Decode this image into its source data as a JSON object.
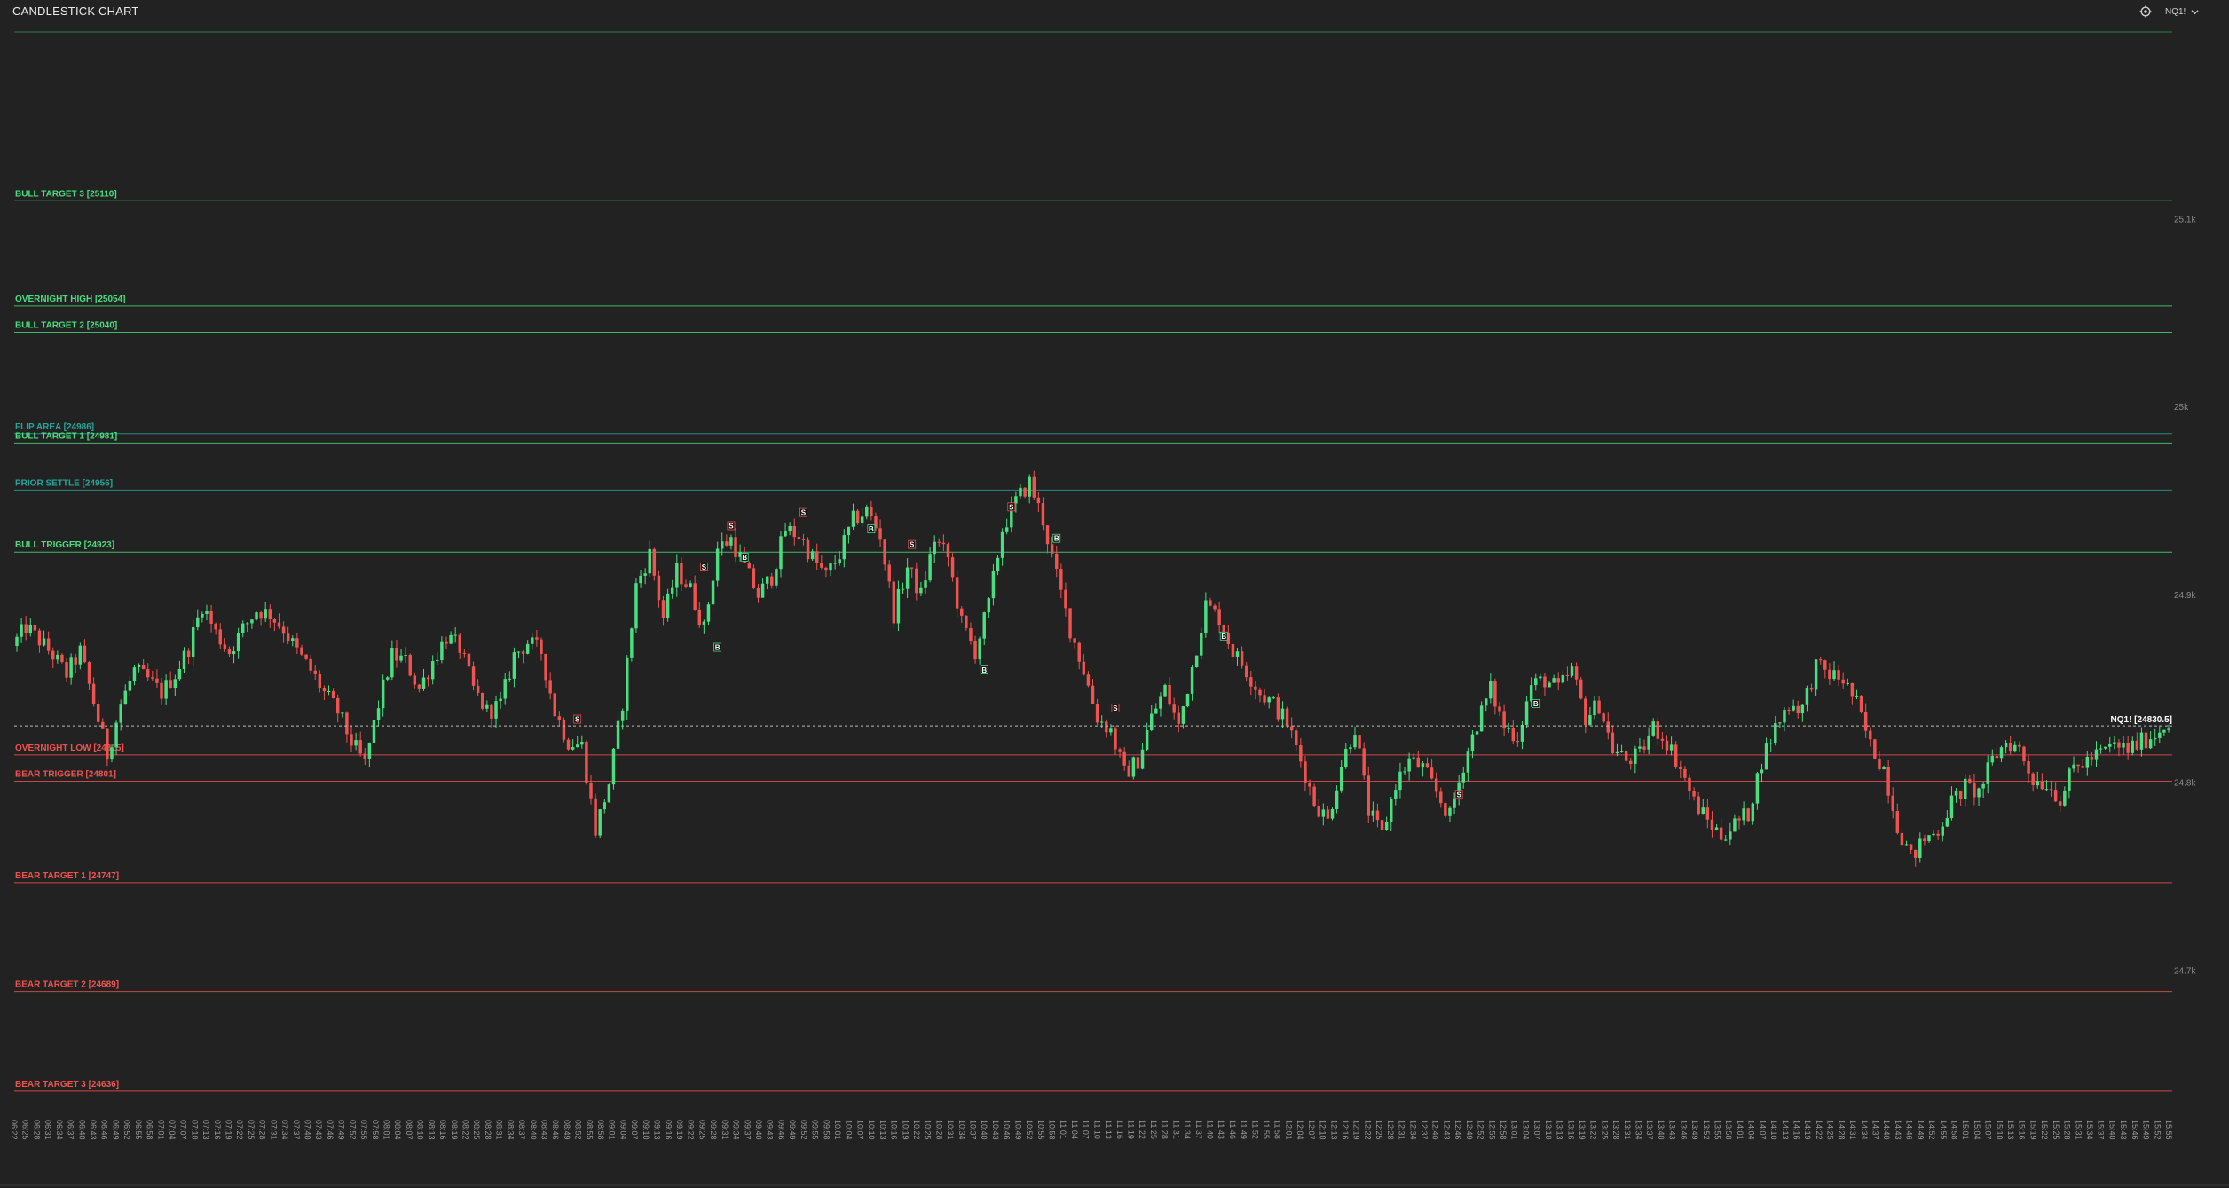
{
  "header": {
    "title": "CANDLESTICK CHART",
    "settings_icon": "gear-icon",
    "symbol": "NQ1!",
    "symbol_dropdown_icon": "chevron-down-icon"
  },
  "colors": {
    "background": "#222222",
    "bull": "#4ade80",
    "bear": "#ef5350",
    "flip": "#26a69a",
    "current_price_line": "#bdbdbd"
  },
  "chart_data": {
    "type": "candlestick",
    "symbol": "NQ1!",
    "ylim": [
      24630,
      25205
    ],
    "y_ticks": [
      {
        "value": 25100,
        "label": "25.1k"
      },
      {
        "value": 25000,
        "label": "25k"
      },
      {
        "value": 24900,
        "label": "24.9k"
      },
      {
        "value": 24800,
        "label": "24.8k"
      },
      {
        "value": 24700,
        "label": "24.7k"
      }
    ],
    "levels": [
      {
        "label": "BULL TARGET 3 [25110]",
        "value": 25110,
        "kind": "bull"
      },
      {
        "label": "OVERNIGHT HIGH [25054]",
        "value": 25054,
        "kind": "bull"
      },
      {
        "label": "BULL TARGET 2 [25040]",
        "value": 25040,
        "kind": "bull"
      },
      {
        "label": "FLIP AREA [24986]",
        "value": 24986,
        "kind": "flip"
      },
      {
        "label": "BULL TARGET 1 [24981]",
        "value": 24981,
        "kind": "bull"
      },
      {
        "label": "PRIOR SETTLE [24956]",
        "value": 24956,
        "kind": "flip"
      },
      {
        "label": "BULL TRIGGER [24923]",
        "value": 24923,
        "kind": "bull"
      },
      {
        "label": "OVERNIGHT LOW [24815]",
        "value": 24815,
        "kind": "bear"
      },
      {
        "label": "BEAR TRIGGER [24801]",
        "value": 24801,
        "kind": "bear"
      },
      {
        "label": "BEAR TARGET 1 [24747]",
        "value": 24747,
        "kind": "bear"
      },
      {
        "label": "BEAR TARGET 2 [24689]",
        "value": 24689,
        "kind": "bear"
      },
      {
        "label": "BEAR TARGET 3 [24636]",
        "value": 24636,
        "kind": "bear"
      }
    ],
    "current_price": {
      "label": "NQ1! [24830.5]",
      "value": 24830.5
    },
    "x_ticks": [
      "06:22",
      "06:25",
      "06:28",
      "06:31",
      "06:34",
      "06:37",
      "06:40",
      "06:43",
      "06:46",
      "06:49",
      "06:52",
      "06:55",
      "06:58",
      "07:01",
      "07:04",
      "07:07",
      "07:10",
      "07:13",
      "07:16",
      "07:19",
      "07:22",
      "07:25",
      "07:28",
      "07:31",
      "07:34",
      "07:37",
      "07:40",
      "07:43",
      "07:46",
      "07:49",
      "07:52",
      "07:55",
      "07:58",
      "08:01",
      "08:04",
      "08:07",
      "08:10",
      "08:13",
      "08:16",
      "08:19",
      "08:22",
      "08:25",
      "08:28",
      "08:31",
      "08:34",
      "08:37",
      "08:40",
      "08:43",
      "08:46",
      "08:49",
      "08:52",
      "08:55",
      "08:58",
      "09:01",
      "09:04",
      "09:07",
      "09:10",
      "09:13",
      "09:16",
      "09:19",
      "09:22",
      "09:25",
      "09:28",
      "09:31",
      "09:34",
      "09:37",
      "09:40",
      "09:43",
      "09:46",
      "09:49",
      "09:52",
      "09:55",
      "09:58",
      "10:01",
      "10:04",
      "10:07",
      "10:10",
      "10:13",
      "10:16",
      "10:19",
      "10:22",
      "10:25",
      "10:28",
      "10:31",
      "10:34",
      "10:37",
      "10:40",
      "10:43",
      "10:46",
      "10:49",
      "10:52",
      "10:55",
      "10:58",
      "11:01",
      "11:04",
      "11:07",
      "11:10",
      "11:13",
      "11:16",
      "11:19",
      "11:22",
      "11:25",
      "11:28",
      "11:31",
      "11:34",
      "11:37",
      "11:40",
      "11:43",
      "11:46",
      "11:49",
      "11:52",
      "11:55",
      "11:58",
      "12:01",
      "12:04",
      "12:07",
      "12:10",
      "12:13",
      "12:16",
      "12:19",
      "12:22",
      "12:25",
      "12:28",
      "12:31",
      "12:34",
      "12:37",
      "12:40",
      "12:43",
      "12:46",
      "12:49",
      "12:52",
      "12:55",
      "12:58",
      "13:01",
      "13:04",
      "13:07",
      "13:10",
      "13:13",
      "13:16",
      "13:19",
      "13:22",
      "13:25",
      "13:28",
      "13:31",
      "13:34",
      "13:37",
      "13:40",
      "13:43",
      "13:46",
      "13:49",
      "13:52",
      "13:55",
      "13:58",
      "14:01",
      "14:04",
      "14:07",
      "14:10",
      "14:13",
      "14:16",
      "14:19",
      "14:22",
      "14:25",
      "14:28",
      "14:31",
      "14:34",
      "14:37",
      "14:40",
      "14:43",
      "14:46",
      "14:49",
      "14:52",
      "14:55",
      "14:58",
      "15:01",
      "15:04",
      "15:07",
      "15:10",
      "15:13",
      "15:16",
      "15:19",
      "15:22",
      "15:25",
      "15:28",
      "15:31",
      "15:34",
      "15:37",
      "15:40",
      "15:43",
      "15:46",
      "15:49",
      "15:52",
      "15:55"
    ],
    "path": [
      24873,
      24883,
      24876,
      24868,
      24858,
      24870,
      24843,
      24815,
      24842,
      24860,
      24855,
      24848,
      24858,
      24872,
      24895,
      24880,
      24870,
      24882,
      24892,
      24890,
      24882,
      24870,
      24860,
      24848,
      24838,
      24822,
      24810,
      24842,
      24868,
      24865,
      24850,
      24865,
      24878,
      24872,
      24850,
      24838,
      24842,
      24868,
      24875,
      24870,
      24838,
      24822,
      24820,
      24775,
      24800,
      24843,
      24905,
      24922,
      24888,
      24913,
      24903,
      24882,
      24925,
      24930,
      24915,
      24900,
      24910,
      24935,
      24932,
      24920,
      24910,
      24922,
      24940,
      24945,
      24932,
      24890,
      24915,
      24900,
      24930,
      24920,
      24885,
      24870,
      24895,
      24935,
      24950,
      24960,
      24940,
      24910,
      24882,
      24860,
      24835,
      24828,
      24805,
      24812,
      24835,
      24850,
      24830,
      24862,
      24895,
      24888,
      24870,
      24860,
      24848,
      24842,
      24832,
      24812,
      24790,
      24780,
      24810,
      24830,
      24785,
      24772,
      24800,
      24812,
      24808,
      24795,
      24782,
      24810,
      24832,
      24850,
      24830,
      24825,
      24852,
      24855,
      24850,
      24860,
      24835,
      24842,
      24818,
      24812,
      24815,
      24830,
      24822,
      24808,
      24790,
      24780,
      24772,
      24778,
      24784,
      24812,
      24830,
      24842,
      24840,
      24862,
      24858,
      24855,
      24842,
      24820,
      24808,
      24778,
      24760,
      24770,
      24775,
      24790,
      24798,
      24795,
      24812,
      24822,
      24818,
      24802,
      24800,
      24792,
      24808,
      24812,
      24816,
      24820,
      24818,
      24822,
      24826,
      24833
    ]
  },
  "signals": [
    {
      "at": 124,
      "type": "sell",
      "text": "S"
    },
    {
      "at": 152,
      "type": "sell",
      "text": "S"
    },
    {
      "at": 155,
      "type": "buy",
      "text": "B"
    },
    {
      "at": 158,
      "type": "sell",
      "text": "S"
    },
    {
      "at": 161,
      "type": "buy",
      "text": "B"
    },
    {
      "at": 174,
      "type": "sell",
      "text": "S"
    },
    {
      "at": 189,
      "type": "buy",
      "text": "B"
    },
    {
      "at": 198,
      "type": "sell",
      "text": "S"
    },
    {
      "at": 214,
      "type": "buy",
      "text": "B"
    },
    {
      "at": 220,
      "type": "sell",
      "text": "S"
    },
    {
      "at": 230,
      "type": "buy",
      "text": "B"
    },
    {
      "at": 243,
      "type": "sell",
      "text": "S"
    },
    {
      "at": 267,
      "type": "buy",
      "text": "B"
    },
    {
      "at": 319,
      "type": "sell",
      "text": "S"
    },
    {
      "at": 336,
      "type": "buy",
      "text": "B"
    }
  ]
}
